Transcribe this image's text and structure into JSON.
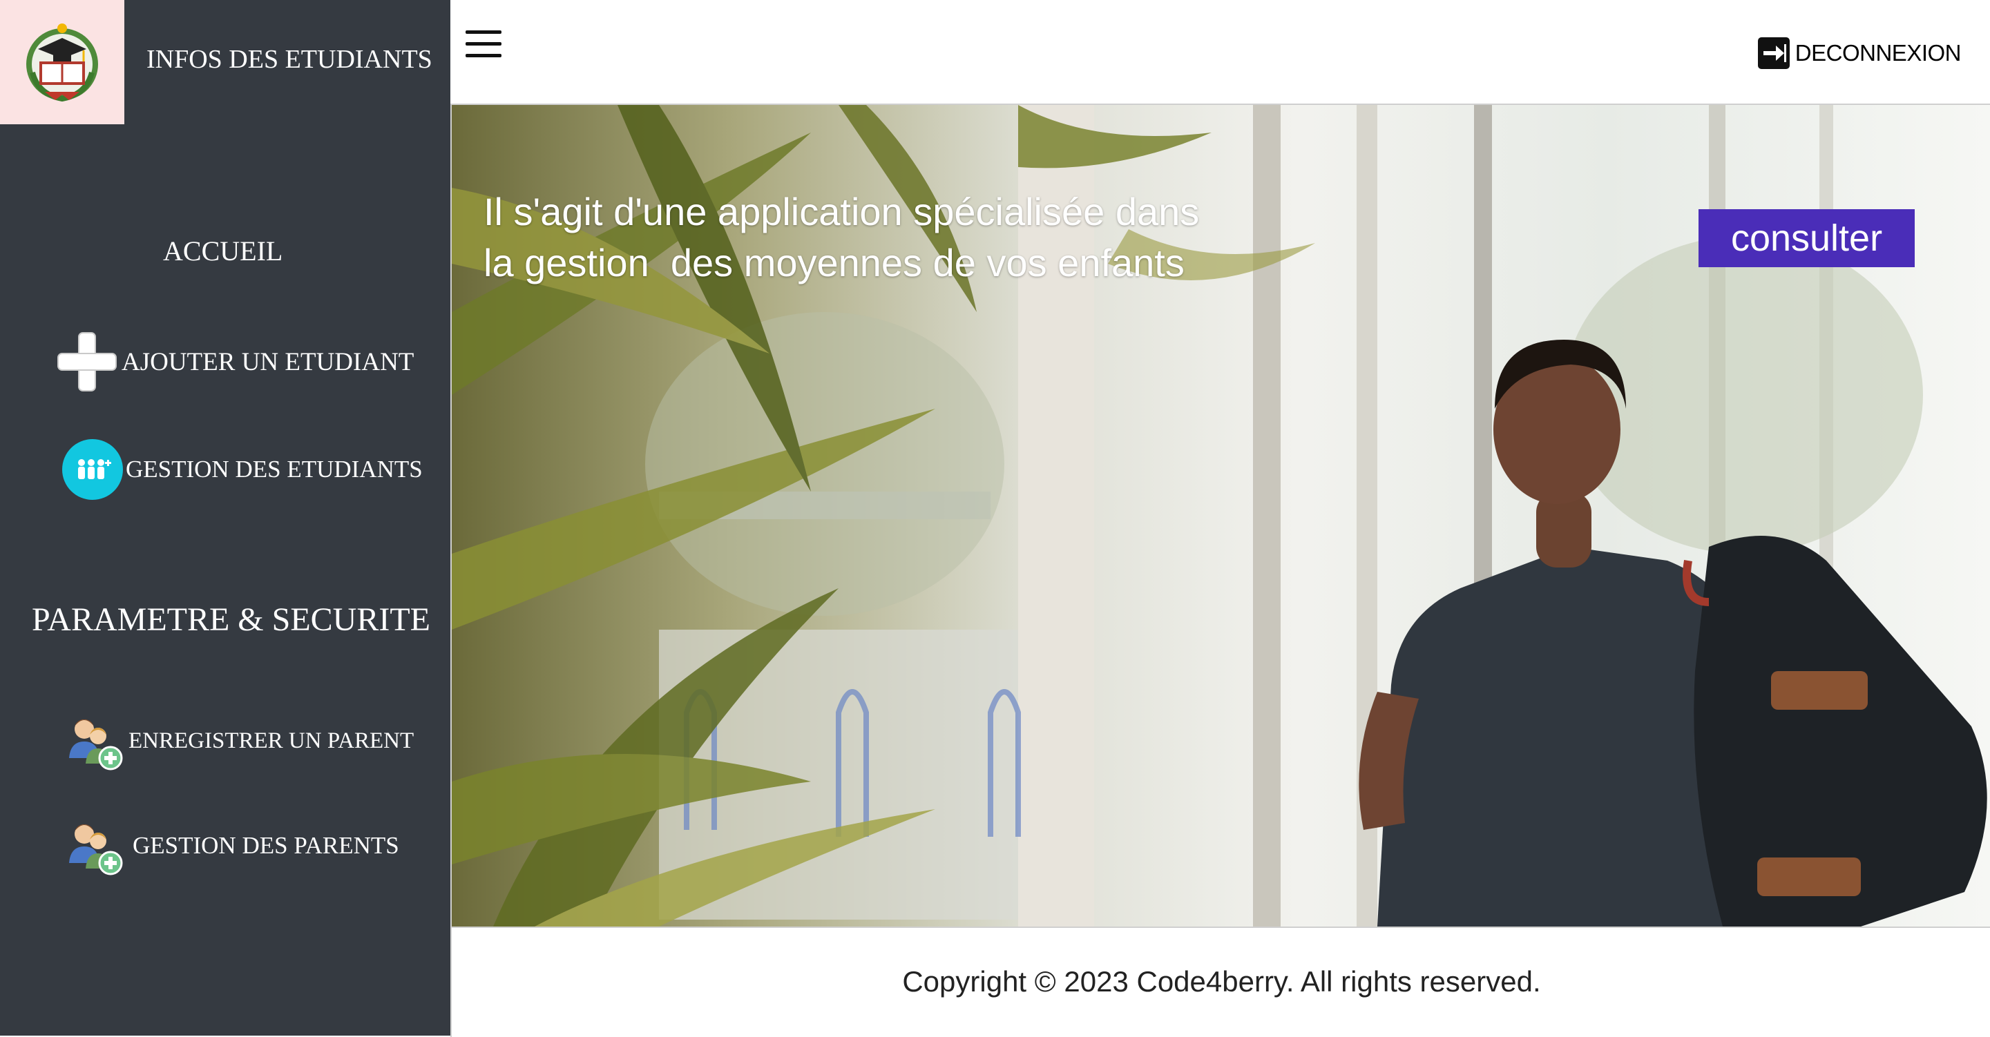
{
  "sidebar": {
    "app_title": "INFOS DES ETUDIANTS",
    "logo_icon": "graduation-cap-book-icon",
    "nav": {
      "accueil": "ACCUEIL",
      "add_student": "AJOUTER UN ETUDIANT",
      "manage_students": "GESTION DES ETUDIANTS"
    },
    "section_title": "PARAMETRE & SECURITE",
    "settings_nav": {
      "register_parent": "ENREGISTRER UN PARENT",
      "manage_parents": "GESTION DES PARENTS"
    },
    "colors": {
      "background": "#353a41",
      "logo_background": "#fbe3e3"
    }
  },
  "topbar": {
    "menu_icon": "hamburger-icon",
    "logout_label": "DECONNEXION",
    "logout_icon": "logout-arrow-icon"
  },
  "hero": {
    "text_line1": "Il s'agit d'une application spécialisée dans",
    "text_line2": "la gestion  des moyennes de vos enfants",
    "cta_label": "consulter",
    "cta_color": "#4a2db8"
  },
  "footer": {
    "copyright": "Copyright © 2023 Code4berry. All rights reserved."
  }
}
